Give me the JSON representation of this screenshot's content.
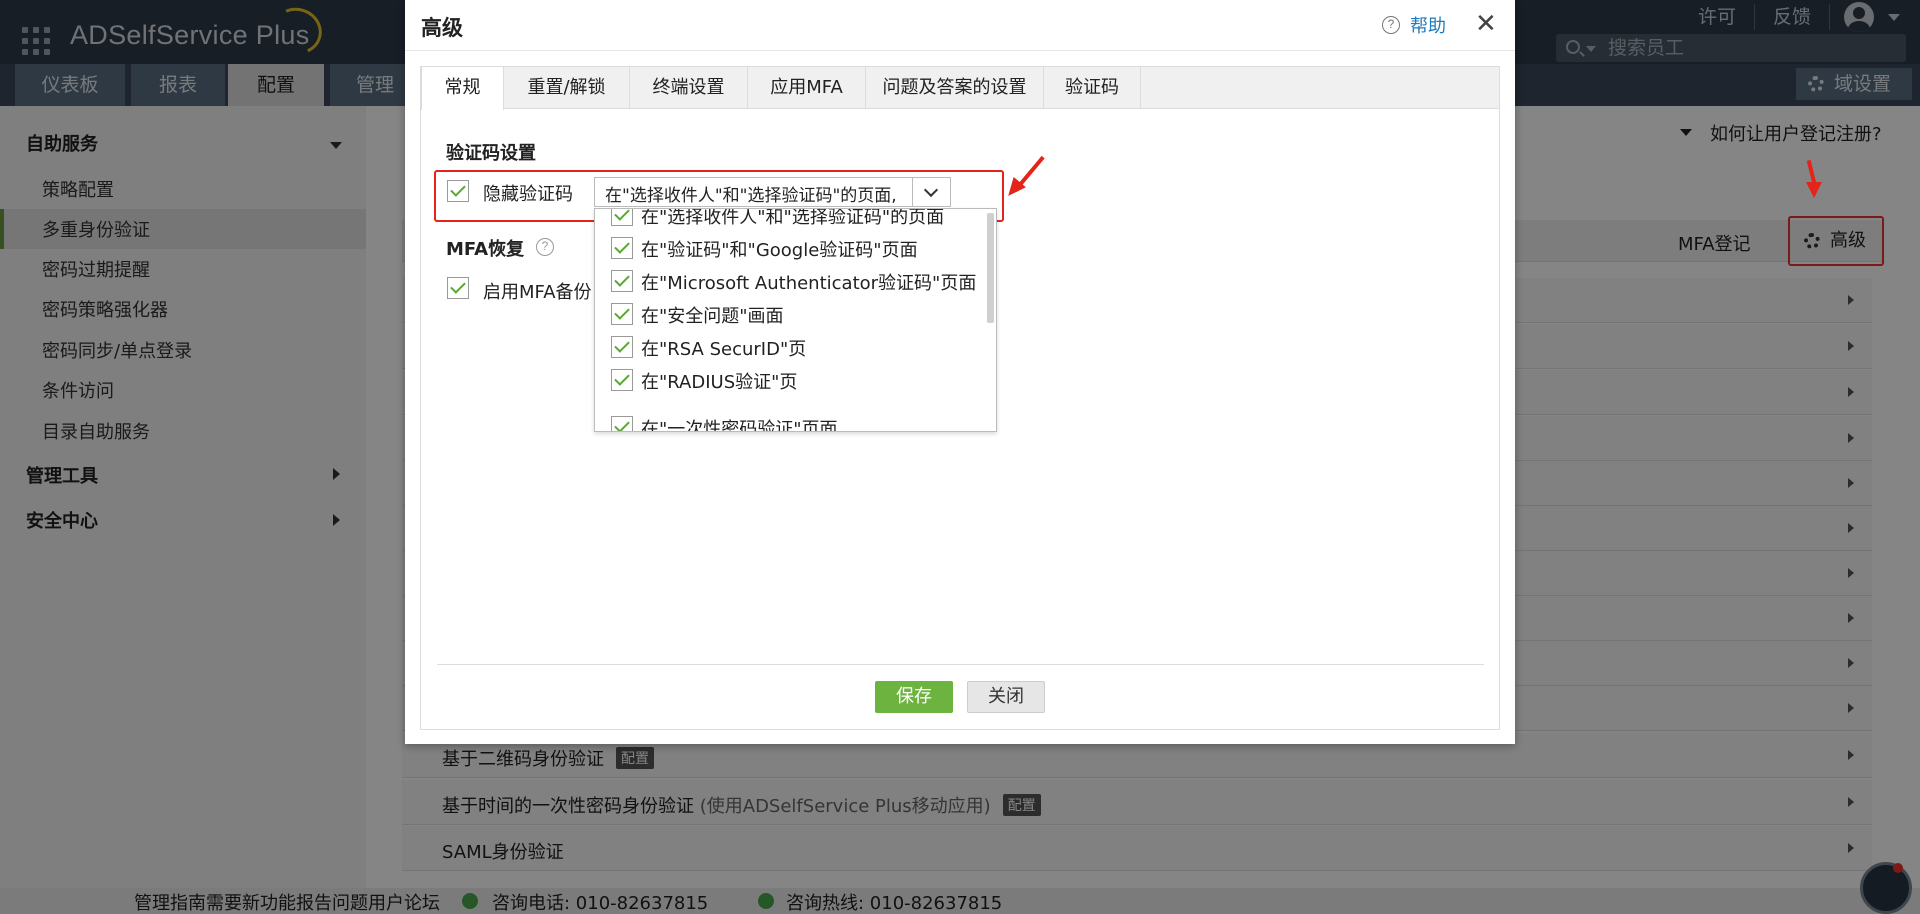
{
  "app": {
    "logo": "ADSelfService Plus"
  },
  "header": {
    "links": [
      "许可",
      "反馈"
    ],
    "search_placeholder": "搜索员工",
    "domain_settings": "域设置"
  },
  "nav_tabs": [
    "仪表板",
    "报表",
    "配置",
    "管理"
  ],
  "sidebar": {
    "section_self_service": "自助服务",
    "items": [
      "策略配置",
      "多重身份验证",
      "密码过期提醒",
      "密码策略强化器",
      "密码同步/单点登录",
      "条件访问",
      "目录自助服务"
    ],
    "section_admin_tools": "管理工具",
    "section_security": "安全中心"
  },
  "main": {
    "help_register": "如何让用户登记注册?",
    "mfa_register": "MFA登记",
    "advanced": "高级",
    "rows": [
      {
        "text": "基于二维码身份验证",
        "badge": "配置"
      },
      {
        "text": "基于时间的一次性密码身份验证",
        "note": "(使用ADSelfService Plus移动应用)",
        "badge": "配置"
      },
      {
        "text": "SAML身份验证"
      }
    ]
  },
  "footer": {
    "links": "管理指南需要新功能报告问题用户论坛",
    "phone1": "咨询电话: 010-82637815",
    "phone2": "咨询热线: 010-82637815"
  },
  "dialog": {
    "title": "高级",
    "help": "帮助",
    "tabs": [
      "常规",
      "重置/解锁",
      "终端设置",
      "应用MFA",
      "问题及答案的设置",
      "验证码"
    ],
    "captcha_section": "验证码设置",
    "hide_captcha_label": "隐藏验证码",
    "hide_captcha_value": "在\"选择收件人\"和\"选择验证码\"的页面,",
    "dropdown_options": [
      "在\"选择收件人\"和\"选择验证码\"的页面",
      "在\"验证码\"和\"Google验证码\"页面",
      "在\"Microsoft Authenticator验证码\"页面",
      "在\"安全问题\"画面",
      "在\"RSA SecurID\"页",
      "在\"RADIUS验证\"页",
      "在\"一次性密码验证\"页面"
    ],
    "mfa_recovery_section": "MFA恢复",
    "enable_mfa_backup": "启用MFA备份",
    "save": "保存",
    "close": "关闭"
  },
  "colors": {
    "accent_green": "#6db33f",
    "link_blue": "#1f7ac0",
    "annotation_red": "#e3241b",
    "topbar": "#2f3b49"
  }
}
